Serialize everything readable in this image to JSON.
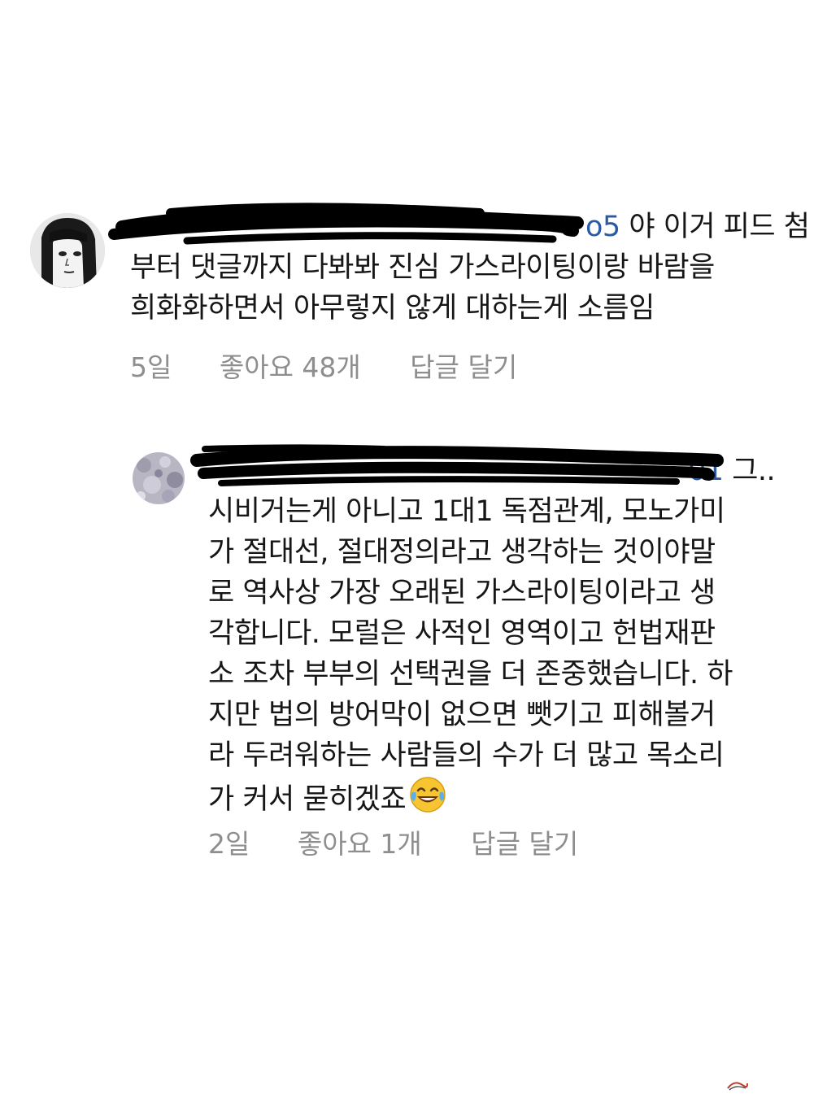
{
  "comments": [
    {
      "username_tail": "o5",
      "lines": [
        "야 이거 피드 첨",
        "부터 댓글까지 다봐봐 진심 가스라이팅이랑 바람을",
        "희화화하면서 아무렇지 않게 대하는게 소름임"
      ],
      "time": "5일",
      "likes": "좋아요 48개",
      "reply": "답글 달기"
    },
    {
      "username_tail": "01",
      "lines": [
        "그..",
        "시비거는게 아니고 1대1 독점관계, 모노가미",
        "가 절대선, 절대정의라고 생각하는 것이야말",
        "로 역사상 가장 오래된 가스라이팅이라고 생",
        "각합니다. 모럴은 사적인 영역이고 헌법재판",
        "소 조차 부부의 선택권을 더 존중했습니다. 하",
        "지만 법의 방어막이 없으면 뺏기고 피해볼거",
        "라 두려워하는 사람들의 수가 더 많고 목소리",
        "가 커서 묻히겠죠"
      ],
      "emoji": "face-with-tears-of-joy",
      "time": "2일",
      "likes": "좋아요 1개",
      "reply": "답글 달기"
    }
  ],
  "colors": {
    "text": "#161616",
    "meta": "#8e8e8e",
    "mention": "#2b5aa5",
    "redaction": "#000000"
  }
}
